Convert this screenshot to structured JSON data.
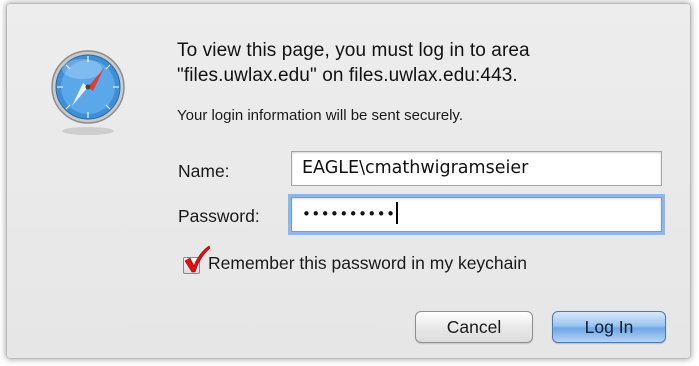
{
  "dialog": {
    "icon": "safari-compass-icon",
    "message": "To view this page, you must log in to area \"files.uwlax.edu\" on files.uwlax.edu:443.",
    "secure_note": "Your login information will be sent securely."
  },
  "form": {
    "name_label": "Name:",
    "name_value": "EAGLE\\cmathwigramseier",
    "password_label": "Password:",
    "password_mask": "••••••••••",
    "remember_label": "Remember this password in my keychain",
    "remember_checked": true
  },
  "buttons": {
    "cancel_label": "Cancel",
    "login_label": "Log In"
  },
  "colors": {
    "checkmark": "#e01010",
    "focus_ring": "#8fb6e6",
    "default_button": "#6fa6e4"
  }
}
